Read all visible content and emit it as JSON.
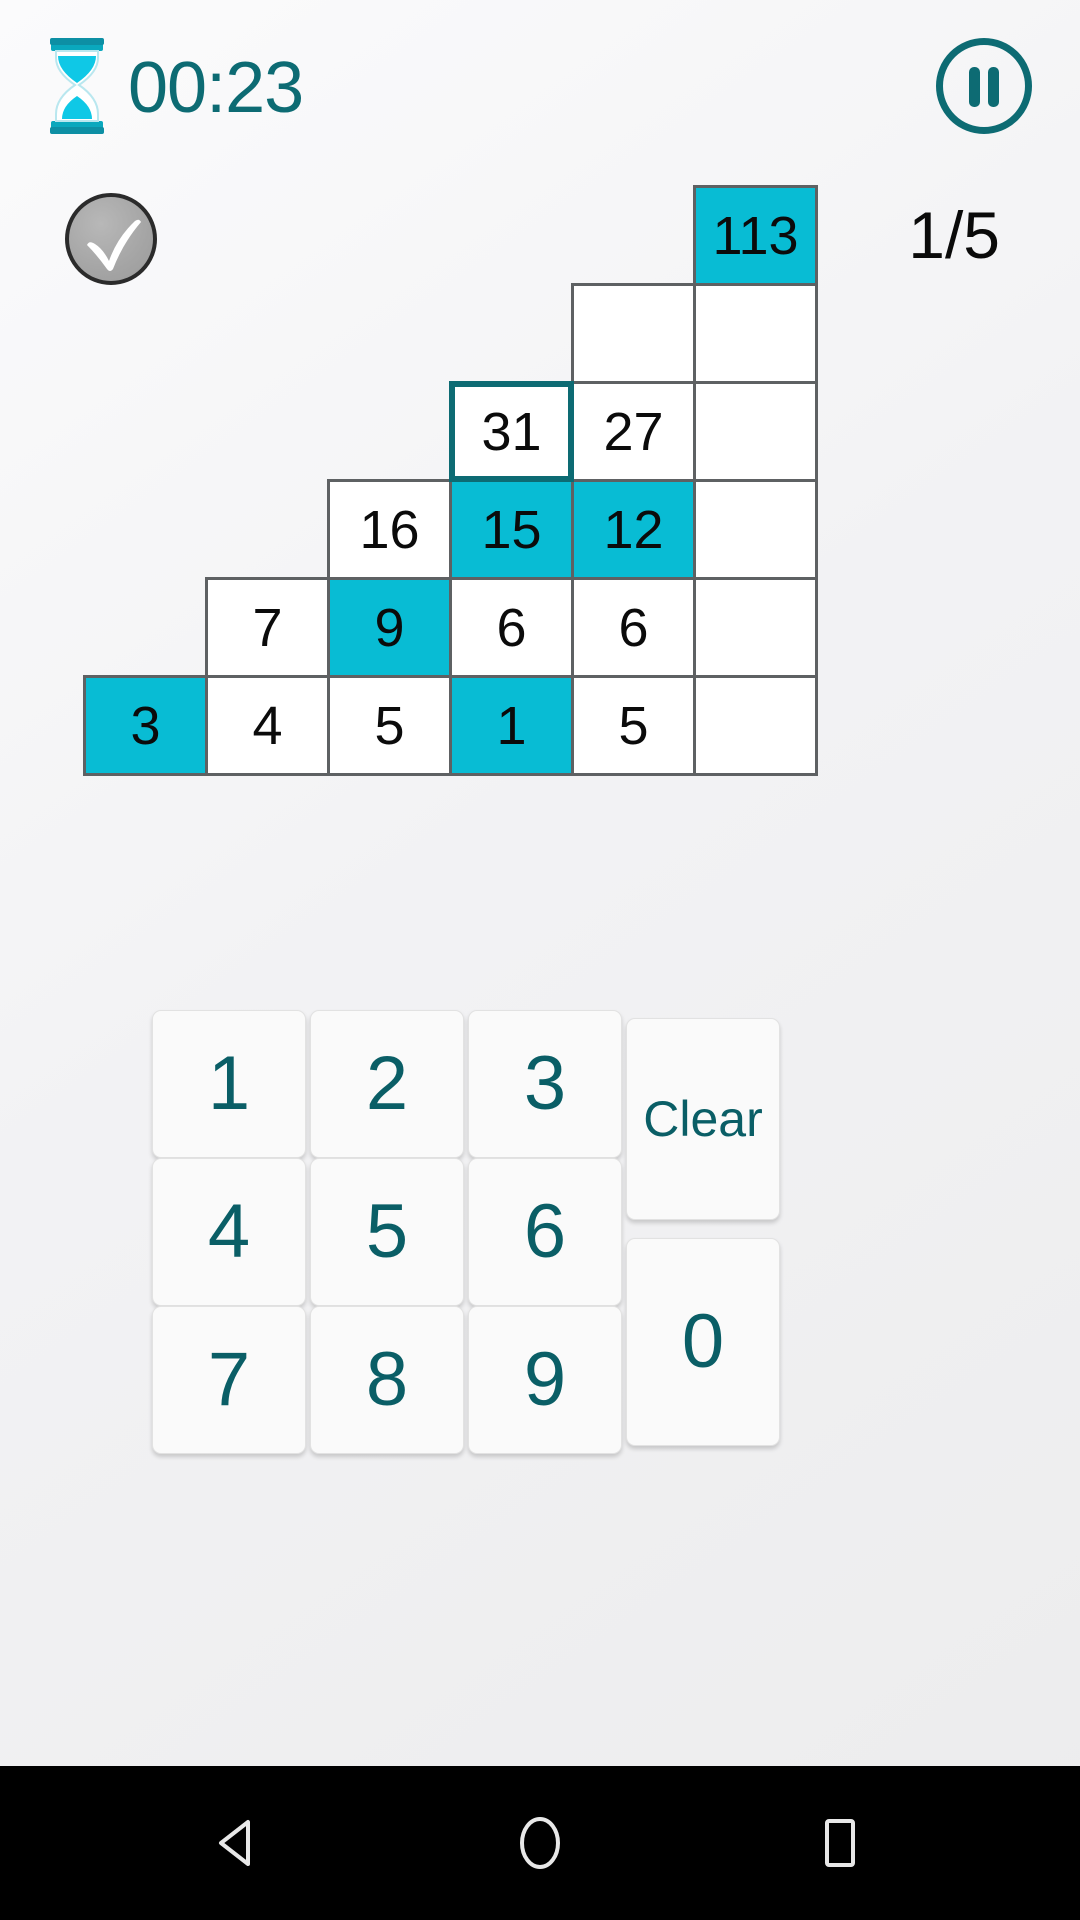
{
  "app": {
    "title": "Number Pyramid Puzzle",
    "accent_cyan": "#08bcd4",
    "accent_teal": "#0d6b73",
    "cell_border": "#5e6163",
    "background": "#f2f2f4"
  },
  "topbar": {
    "timer": "00:23",
    "timer_icon": "hourglass-icon",
    "pause_icon": "pause-icon",
    "pause_label": "Pause"
  },
  "status": {
    "check_icon": "check-icon",
    "check_label": "Check",
    "level_indicator": "1/5"
  },
  "pyramid": {
    "rows": [
      {
        "index": 1,
        "cells": [
          {
            "value": "113",
            "filled": true,
            "selected": false
          }
        ]
      },
      {
        "index": 2,
        "cells": [
          {
            "value": "",
            "filled": false,
            "selected": false
          },
          {
            "value": "",
            "filled": false,
            "selected": false
          }
        ]
      },
      {
        "index": 3,
        "cells": [
          {
            "value": "31",
            "filled": false,
            "selected": true
          },
          {
            "value": "27",
            "filled": false,
            "selected": false
          },
          {
            "value": "",
            "filled": false,
            "selected": false
          }
        ]
      },
      {
        "index": 4,
        "cells": [
          {
            "value": "16",
            "filled": false,
            "selected": false
          },
          {
            "value": "15",
            "filled": true,
            "selected": false
          },
          {
            "value": "12",
            "filled": true,
            "selected": false
          },
          {
            "value": "",
            "filled": false,
            "selected": false
          }
        ]
      },
      {
        "index": 5,
        "cells": [
          {
            "value": "7",
            "filled": false,
            "selected": false
          },
          {
            "value": "9",
            "filled": true,
            "selected": false
          },
          {
            "value": "6",
            "filled": false,
            "selected": false
          },
          {
            "value": "6",
            "filled": false,
            "selected": false
          },
          {
            "value": "",
            "filled": false,
            "selected": false
          }
        ]
      },
      {
        "index": 6,
        "cells": [
          {
            "value": "3",
            "filled": true,
            "selected": false
          },
          {
            "value": "4",
            "filled": false,
            "selected": false
          },
          {
            "value": "5",
            "filled": false,
            "selected": false
          },
          {
            "value": "1",
            "filled": true,
            "selected": false
          },
          {
            "value": "5",
            "filled": false,
            "selected": false
          },
          {
            "value": "",
            "filled": false,
            "selected": false
          }
        ]
      }
    ]
  },
  "keypad": {
    "keys": [
      {
        "label": "1",
        "type": "num"
      },
      {
        "label": "2",
        "type": "num"
      },
      {
        "label": "3",
        "type": "num"
      },
      {
        "label": "4",
        "type": "num"
      },
      {
        "label": "5",
        "type": "num"
      },
      {
        "label": "6",
        "type": "num"
      },
      {
        "label": "7",
        "type": "num"
      },
      {
        "label": "8",
        "type": "num"
      },
      {
        "label": "9",
        "type": "num"
      }
    ],
    "clear_label": "Clear",
    "zero_label": "0"
  },
  "navbar": {
    "back_icon": "back-triangle-icon",
    "back_label": "Back",
    "home_icon": "home-circle-icon",
    "home_label": "Home",
    "recents_icon": "recents-square-icon",
    "recents_label": "Recents"
  }
}
